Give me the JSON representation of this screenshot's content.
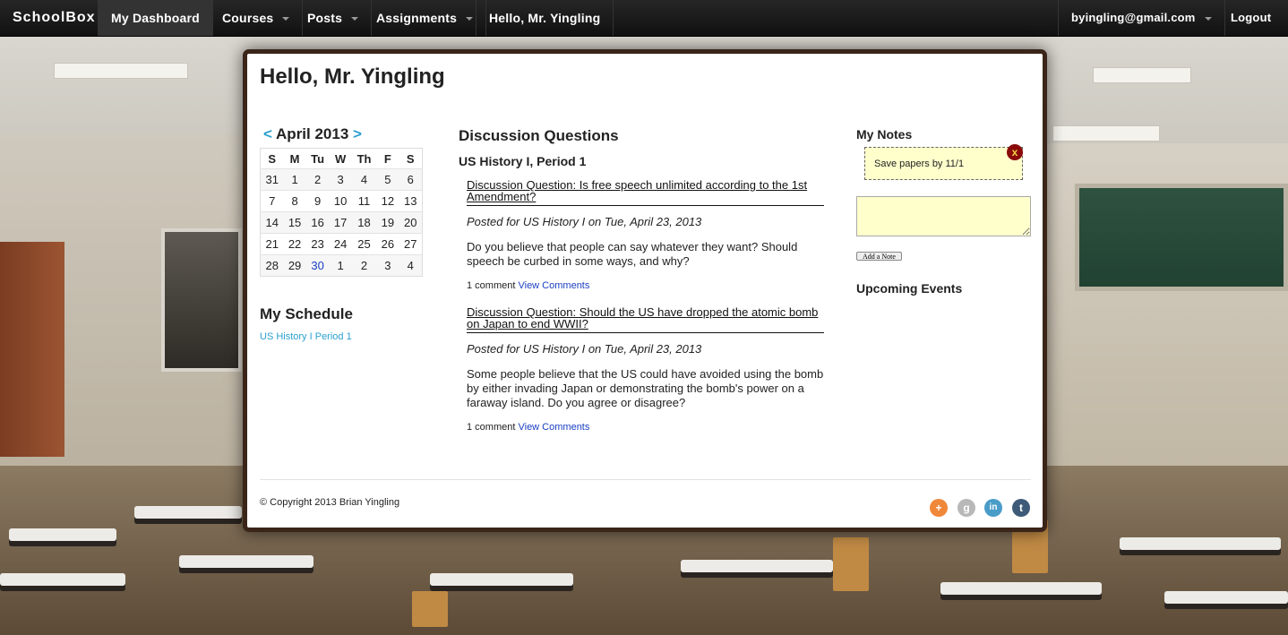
{
  "nav": {
    "brand": "SchoolBox",
    "items": [
      {
        "label": "My Dashboard",
        "active": true
      },
      {
        "label": "Courses"
      },
      {
        "label": "Posts"
      },
      {
        "label": "Assignments"
      },
      {
        "label": "Hello, Mr. Yingling"
      }
    ],
    "account_email": "byingling@gmail.com",
    "logout": "Logout"
  },
  "page": {
    "title": "Hello, Mr. Yingling"
  },
  "calendar": {
    "prev": "<",
    "next": ">",
    "month_label": "April 2013",
    "weekdays": [
      "S",
      "M",
      "Tu",
      "W",
      "Th",
      "F",
      "S"
    ],
    "weeks": [
      [
        "31",
        "1",
        "2",
        "3",
        "4",
        "5",
        "6"
      ],
      [
        "7",
        "8",
        "9",
        "10",
        "11",
        "12",
        "13"
      ],
      [
        "14",
        "15",
        "16",
        "17",
        "18",
        "19",
        "20"
      ],
      [
        "21",
        "22",
        "23",
        "24",
        "25",
        "26",
        "27"
      ],
      [
        "28",
        "29",
        "30",
        "1",
        "2",
        "3",
        "4"
      ]
    ],
    "today": "30"
  },
  "schedule": {
    "title": "My Schedule",
    "items": [
      "US History I Period 1"
    ]
  },
  "discussion": {
    "title": "Discussion Questions",
    "course": "US History I, Period 1",
    "posts": [
      {
        "question": "Discussion Question: Is free speech unlimited according to the 1st Amendment?",
        "meta": "Posted for US History I on Tue, April 23, 2013",
        "body": "Do you believe that people can say whatever they want? Should speech be curbed in some ways, and why?",
        "comments": "1 comment",
        "view_link": "View Comments"
      },
      {
        "question": "Discussion Question: Should the US have dropped the atomic bomb on Japan to end WWII?",
        "meta": "Posted for US History I on Tue, April 23, 2013",
        "body": "Some people believe that the US could have avoided using the bomb by either invading Japan or demonstrating the bomb's power on a faraway island. Do you agree or disagree?",
        "comments": "1 comment",
        "view_link": "View Comments"
      }
    ]
  },
  "notes": {
    "title": "My Notes",
    "items": [
      "Save papers by 11/1"
    ],
    "close_glyph": "x",
    "input_value": "",
    "add_button": "Add a Note"
  },
  "events": {
    "title": "Upcoming Events"
  },
  "footer": {
    "copyright": "© Copyright 2013 Brian Yingling",
    "social": [
      {
        "name": "add",
        "glyph": "+",
        "color": "#f0883a"
      },
      {
        "name": "google",
        "glyph": "g",
        "color": "#b8b8b8"
      },
      {
        "name": "linkedin",
        "glyph": "in",
        "color": "#4a9cc8"
      },
      {
        "name": "tumblr",
        "glyph": "t",
        "color": "#3d5a78"
      }
    ]
  }
}
